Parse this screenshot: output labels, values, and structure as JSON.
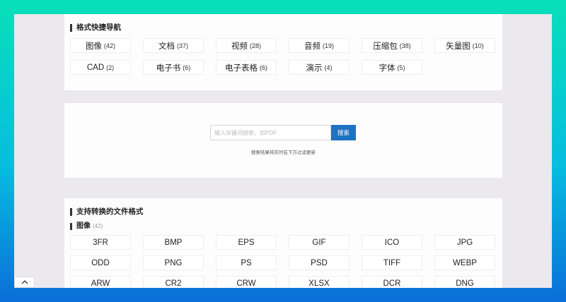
{
  "quick_nav": {
    "title": "格式快捷导航",
    "items": [
      {
        "label": "图像",
        "count": "(42)"
      },
      {
        "label": "文档",
        "count": "(37)"
      },
      {
        "label": "视频",
        "count": "(28)"
      },
      {
        "label": "音频",
        "count": "(19)"
      },
      {
        "label": "压缩包",
        "count": "(38)"
      },
      {
        "label": "矢量图",
        "count": "(10)"
      },
      {
        "label": "CAD",
        "count": "(2)"
      },
      {
        "label": "电子书",
        "count": "(6)"
      },
      {
        "label": "电子表格",
        "count": "(6)"
      },
      {
        "label": "演示",
        "count": "(4)"
      },
      {
        "label": "字体",
        "count": "(5)"
      }
    ]
  },
  "search": {
    "placeholder": "输入关键词搜索，如PDF",
    "button_label": "搜索",
    "hint": "搜索结果将实时在下方过滤更新"
  },
  "formats": {
    "title": "支持转换的文件格式",
    "groups": [
      {
        "name": "图像",
        "count": "(42)",
        "items": [
          "3FR",
          "BMP",
          "EPS",
          "GIF",
          "ICO",
          "JPG",
          "ODD",
          "PNG",
          "PS",
          "PSD",
          "TIFF",
          "WEBP",
          "ARW",
          "CR2",
          "CRW",
          "XLSX",
          "DCR",
          "DNG"
        ]
      }
    ]
  },
  "icons": {
    "back_to_top": "chevron-up-icon"
  },
  "colors": {
    "accent": "#1d72c4"
  }
}
